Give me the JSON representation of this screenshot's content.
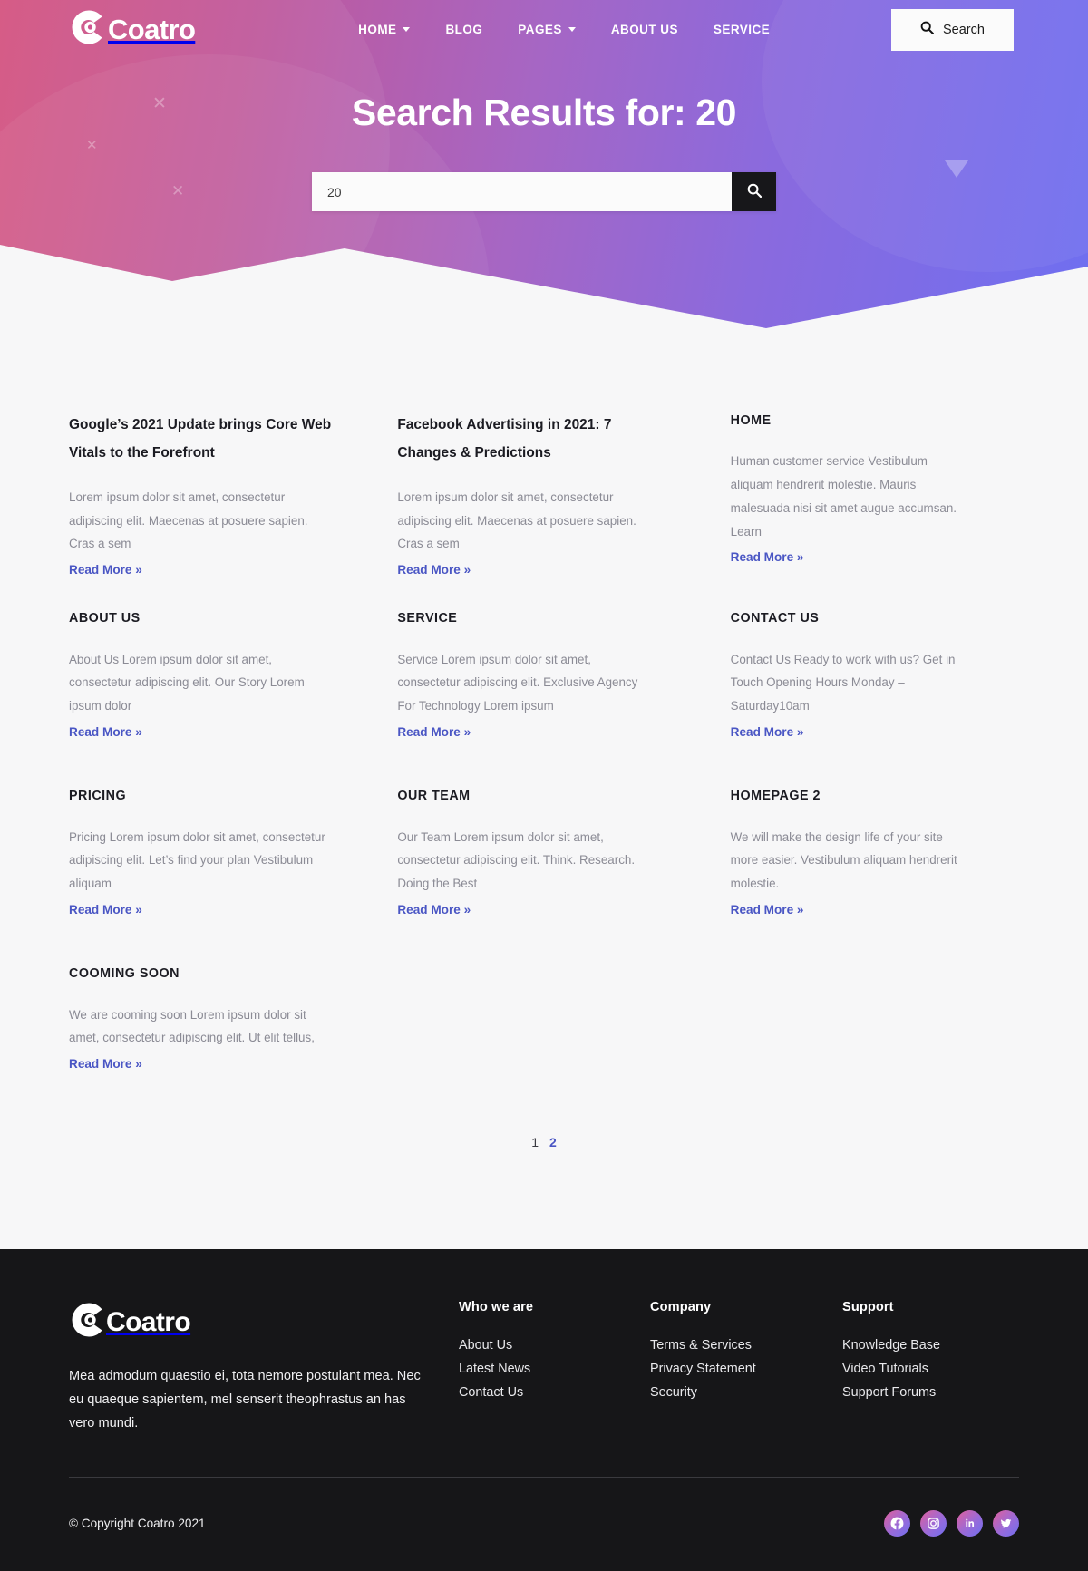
{
  "brand": {
    "name": "Coatro",
    "logo_icon": "coatro-logo-icon"
  },
  "nav": {
    "items": [
      {
        "label": "HOME",
        "has_dropdown": true
      },
      {
        "label": "BLOG",
        "has_dropdown": false
      },
      {
        "label": "PAGES",
        "has_dropdown": true
      },
      {
        "label": "ABOUT US",
        "has_dropdown": false
      },
      {
        "label": "SERVICE",
        "has_dropdown": false
      }
    ],
    "search_button": {
      "label": "Search",
      "icon": "search-icon"
    }
  },
  "hero": {
    "title": "Search Results for: 20",
    "search": {
      "value": "20",
      "placeholder": "Search …",
      "submit_icon": "search-icon"
    },
    "gradient_from": "#d4527f",
    "gradient_to": "#6f6ff0"
  },
  "results": {
    "read_more_label": "Read More »",
    "items": [
      {
        "title": "Google’s 2021 Update brings Core Web Vitals to the Forefront",
        "uppercase": false,
        "desc": "Lorem ipsum dolor sit amet, consectetur adipiscing elit. Maecenas at posuere sapien. Cras a sem"
      },
      {
        "title": "Facebook Advertising in 2021: 7 Changes & Predictions",
        "uppercase": false,
        "desc": "Lorem ipsum dolor sit amet, consectetur adipiscing elit. Maecenas at posuere sapien. Cras a sem"
      },
      {
        "title": "HOME",
        "uppercase": true,
        "desc": "Human customer service Vestibulum aliquam hendrerit molestie. Mauris malesuada nisi sit amet augue accumsan. Learn"
      },
      {
        "title": "ABOUT US",
        "uppercase": true,
        "desc": "About Us Lorem ipsum dolor sit amet, consectetur adipiscing elit.  Our Story Lorem ipsum dolor"
      },
      {
        "title": "SERVICE",
        "uppercase": true,
        "desc": "Service Lorem ipsum dolor sit amet, consectetur adipiscing elit.  Exclusive Agency For Technology Lorem ipsum"
      },
      {
        "title": "CONTACT US",
        "uppercase": true,
        "desc": "Contact Us Ready to work with us? Get in Touch Opening Hours Monday – Saturday10am"
      },
      {
        "title": "PRICING",
        "uppercase": true,
        "desc": "Pricing Lorem ipsum dolor sit amet, consectetur adipiscing elit.  Let’s find your plan Vestibulum aliquam"
      },
      {
        "title": "OUR TEAM",
        "uppercase": true,
        "desc": "Our Team Lorem ipsum dolor sit amet, consectetur adipiscing elit.  Think. Research. Doing the Best"
      },
      {
        "title": "HOMEPAGE 2",
        "uppercase": true,
        "desc": "We will make the design life of your site more easier. Vestibulum aliquam hendrerit molestie."
      },
      {
        "title": "COOMING SOON",
        "uppercase": true,
        "desc": "We are cooming soon Lorem ipsum dolor sit amet, consectetur adipiscing elit. Ut elit tellus,"
      }
    ],
    "pagination": [
      {
        "label": "1",
        "current": true
      },
      {
        "label": "2",
        "current": false
      }
    ]
  },
  "footer": {
    "brand_name": "Coatro",
    "description": "Mea admodum quaestio ei, tota nemore postulant mea. Nec eu quaeque sapientem, mel senserit theophrastus an has vero mundi.",
    "columns": [
      {
        "heading": "Who we are",
        "links": [
          "About Us",
          "Latest News",
          "Contact Us"
        ]
      },
      {
        "heading": "Company",
        "links": [
          "Terms & Services",
          "Privacy Statement",
          "Security"
        ]
      },
      {
        "heading": "Support",
        "links": [
          "Knowledge Base",
          "Video Tutorials",
          "Support Forums"
        ]
      }
    ],
    "copyright": "© Copyright Coatro 2021",
    "socials": [
      {
        "name": "facebook-icon"
      },
      {
        "name": "instagram-icon"
      },
      {
        "name": "linkedin-icon"
      },
      {
        "name": "twitter-icon"
      }
    ]
  }
}
